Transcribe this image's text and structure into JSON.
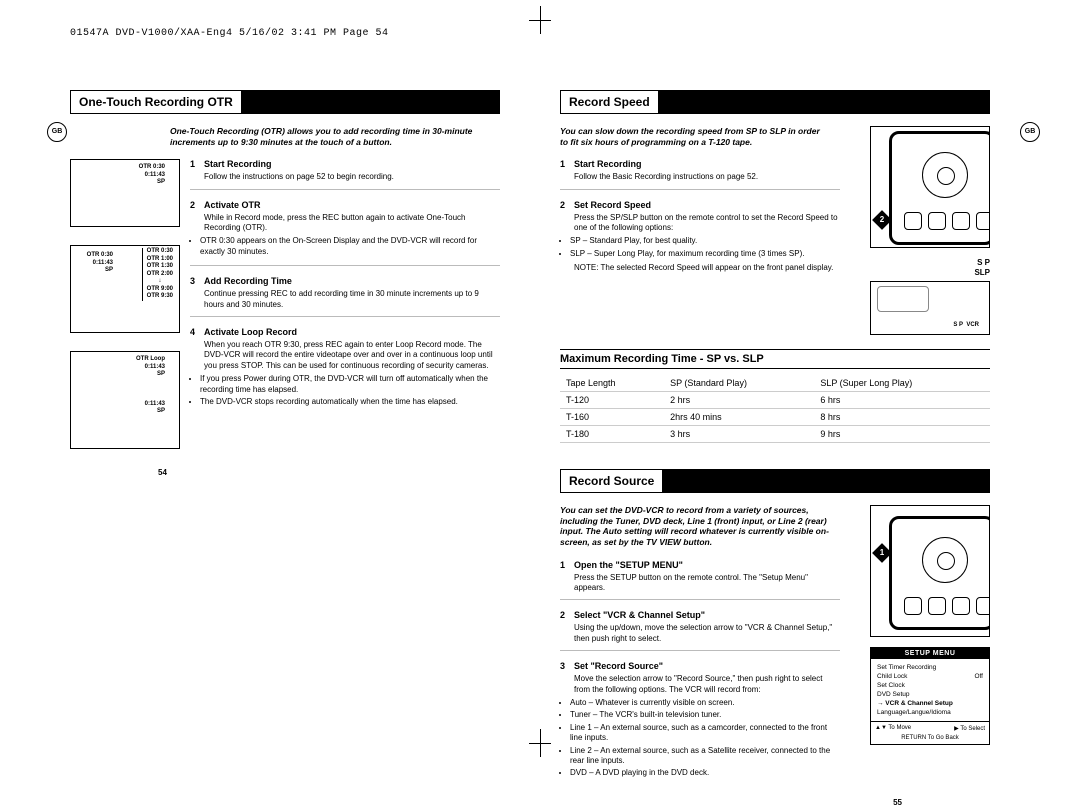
{
  "header": "01547A DVD-V1000/XAA-Eng4  5/16/02 3:41 PM  Page 54",
  "gb_label": "GB",
  "left": {
    "title": "One-Touch Recording OTR",
    "intro": "One-Touch Recording (OTR) allows you to add recording time in 30-minute increments up to 9:30 minutes at the touch of a button.",
    "figures": {
      "f1": [
        "OTR 0:30",
        "0:11:43",
        "SP"
      ],
      "f2_left": [
        "OTR 0:30",
        "0:11:43",
        "SP"
      ],
      "f2_right": [
        "OTR 0:30",
        "OTR 1:00",
        "OTR 1:30",
        "OTR 2:00",
        "↓",
        "OTR 9:00",
        "OTR 9:30"
      ],
      "f3_top": [
        "OTR Loop",
        "0:11:43",
        "SP"
      ],
      "f3_bot": [
        "0:11:43",
        "SP"
      ]
    },
    "steps": [
      {
        "num": "1",
        "title": "Start Recording",
        "body": "Follow the instructions on page 52 to begin recording.",
        "bullets": []
      },
      {
        "num": "2",
        "title": "Activate OTR",
        "body": "While in Record mode, press the REC button again to activate One-Touch Recording (OTR).",
        "bullets": [
          "OTR 0:30 appears on the On-Screen Display and the DVD-VCR will record for exactly 30 minutes."
        ]
      },
      {
        "num": "3",
        "title": "Add Recording Time",
        "body": "Continue pressing REC to add recording time in 30 minute increments up to 9 hours and 30 minutes.",
        "bullets": []
      },
      {
        "num": "4",
        "title": "Activate Loop Record",
        "body": "When you reach OTR 9:30, press REC again to enter Loop Record mode. The DVD-VCR will record the entire videotape over and over in a continuous loop until you press STOP. This can be used for continuous recording of security cameras.",
        "bullets": [
          "If you press Power during OTR, the DVD-VCR will turn off automatically when the recording time has elapsed.",
          "The DVD-VCR stops recording automatically when the time has elapsed."
        ]
      }
    ],
    "page_num": "54"
  },
  "right": {
    "section1": {
      "title": "Record Speed",
      "intro": "You can slow down the recording speed from SP to SLP in order to fit six hours of programming on a T-120 tape.",
      "sp_slp": {
        "line1": "S P",
        "line2": "SLP"
      },
      "display": {
        "sp": "S P",
        "vcr": "VCR"
      },
      "steps": [
        {
          "num": "1",
          "title": "Start Recording",
          "body": "Follow the Basic Recording instructions on page 52.",
          "bullets": []
        },
        {
          "num": "2",
          "title": "Set Record Speed",
          "body": "Press the SP/SLP button on the remote control to set the Record Speed to one of the following options:",
          "bullets": [
            "SP – Standard Play, for best quality.",
            "SLP – Super Long Play, for maximum recording time (3 times SP)."
          ],
          "note": "NOTE: The selected Record Speed will appear on the front panel display."
        }
      ],
      "table_title": "Maximum Recording Time - SP vs. SLP",
      "table": {
        "headers": [
          "Tape Length",
          "SP (Standard Play)",
          "SLP (Super Long Play)"
        ],
        "rows": [
          [
            "T-120",
            "2 hrs",
            "6 hrs"
          ],
          [
            "T-160",
            "2hrs 40 mins",
            "8 hrs"
          ],
          [
            "T-180",
            "3 hrs",
            "9 hrs"
          ]
        ]
      }
    },
    "section2": {
      "title": "Record Source",
      "intro": "You can set the DVD-VCR to record from a variety of sources, including the Tuner, DVD deck, Line 1 (front) input, or Line 2 (rear) input. The Auto setting will record whatever is currently visible on-screen, as set by the TV VIEW button.",
      "steps": [
        {
          "num": "1",
          "title": "Open the \"SETUP MENU\"",
          "body": "Press the SETUP button on the remote control. The \"Setup Menu\" appears.",
          "bullets": []
        },
        {
          "num": "2",
          "title": "Select \"VCR & Channel Setup\"",
          "body": "Using the up/down, move the selection arrow to \"VCR & Channel Setup,\" then push right to select.",
          "bullets": []
        },
        {
          "num": "3",
          "title": "Set \"Record Source\"",
          "body": "Move the selection arrow to \"Record Source,\" then push right to select from the following options. The VCR will record from:",
          "bullets": [
            "Auto – Whatever is currently visible on screen.",
            "Tuner – The VCR's built-in television tuner.",
            "Line 1 – An external source, such as a camcorder, connected to the front line inputs.",
            "Line 2 – An external source, such as a Satellite receiver, connected to the rear line inputs.",
            "DVD – A DVD playing in the DVD deck."
          ]
        }
      ],
      "menu": {
        "header": "SETUP MENU",
        "items": [
          [
            "Set Timer Recording",
            ""
          ],
          [
            "Child Lock",
            "Off"
          ],
          [
            "Set Clock",
            ""
          ],
          [
            "DVD Setup",
            ""
          ],
          [
            "→ VCR & Channel Setup",
            ""
          ],
          [
            "Language/Langue/Idioma",
            ""
          ]
        ],
        "footer_left": "▲▼ To Move",
        "footer_right": "▶ To Select",
        "footer_bottom": "RETURN To Go Back"
      }
    },
    "page_num": "55"
  }
}
